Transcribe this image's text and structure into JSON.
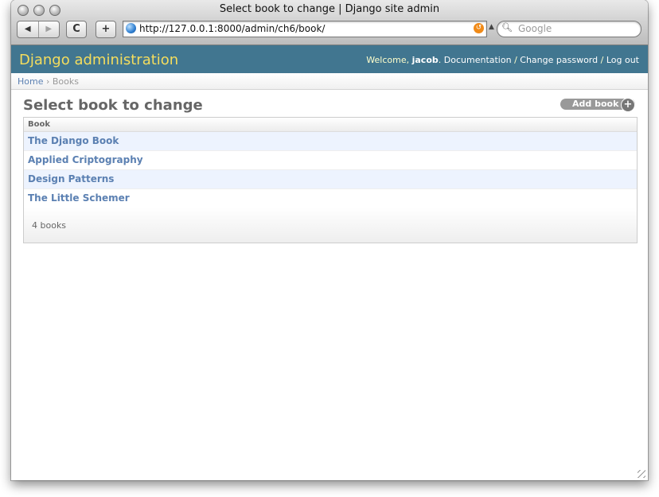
{
  "browser": {
    "window_title": "Select book to change | Django site admin",
    "url": "http://127.0.0.1:8000/admin/ch6/book/",
    "search_placeholder": "Google",
    "back_glyph": "◀",
    "forward_glyph": "▶",
    "reload_glyph": "C",
    "newtab_glyph": "+"
  },
  "admin": {
    "site_name": "Django administration",
    "welcome_text": "Welcome, ",
    "username": "jacob",
    "links": {
      "documentation": "Documentation",
      "change_password": "Change password",
      "logout": "Log out"
    },
    "separator": " / "
  },
  "breadcrumbs": {
    "home": "Home",
    "separator": " › ",
    "current": "Books"
  },
  "page": {
    "title": "Select book to change",
    "add_button": "Add book",
    "add_glyph": "+"
  },
  "results": {
    "column_header": "Book",
    "rows": [
      "The Django Book",
      "Applied Criptography",
      "Design Patterns",
      "The Little Schemer"
    ],
    "count_text": "4 books"
  },
  "colors": {
    "header_bg": "#417690",
    "site_name": "#f5dd5d",
    "link": "#5b80b2",
    "row_alt": "#edf3fe"
  }
}
